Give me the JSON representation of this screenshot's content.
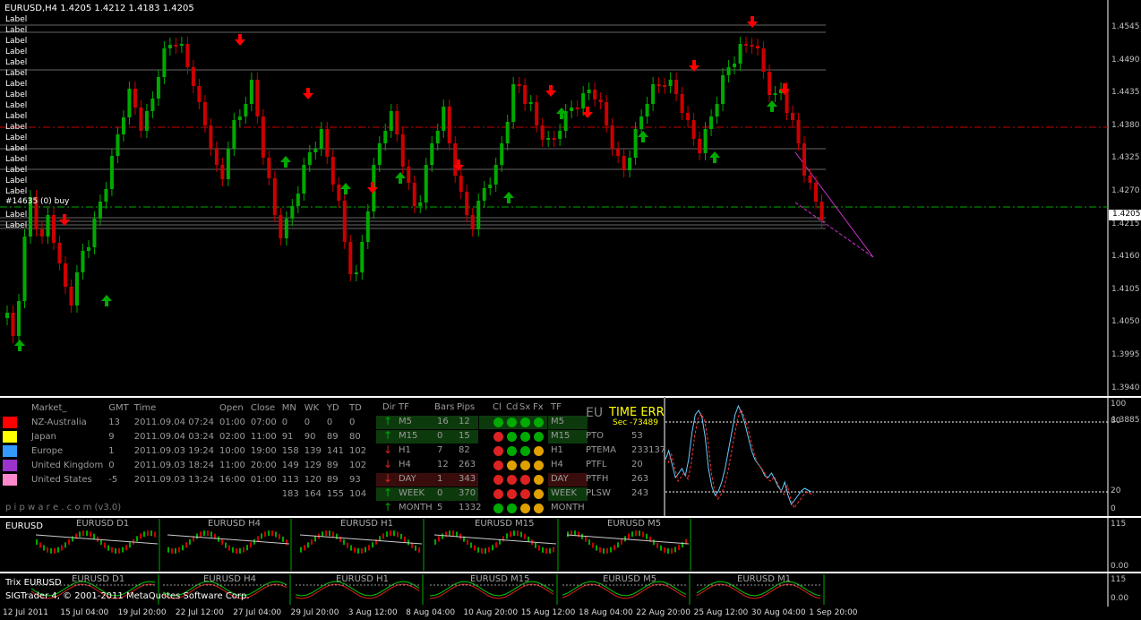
{
  "symbol_header": "EURUSD,H4  1.4205 1.4212 1.4183 1.4205",
  "price_axis": [
    "1.4545",
    "1.4490",
    "1.4435",
    "1.4380",
    "1.4325",
    "1.4270",
    "1.4215",
    "1.4160",
    "1.4105",
    "1.4050",
    "1.3995",
    "1.3940",
    "1.3885"
  ],
  "current_price": "1.4205",
  "label_text": "Label",
  "buy_label": "#14635 (0) buy",
  "time_axis": [
    "12 Jul 2011",
    "15 Jul 04:00",
    "19 Jul 20:00",
    "22 Jul 12:00",
    "27 Jul 04:00",
    "29 Jul 20:00",
    "3 Aug 12:00",
    "8 Aug 04:00",
    "10 Aug 20:00",
    "15 Aug 12:00",
    "18 Aug 04:00",
    "22 Aug 20:00",
    "25 Aug 12:00",
    "30 Aug 04:00",
    "1 Sep 20:00"
  ],
  "markets": {
    "headers": [
      "Market_",
      "GMT",
      "Time",
      "Open",
      "Close",
      "MN",
      "WK",
      "YD",
      "TD"
    ],
    "rows": [
      {
        "name": "NZ-Australia",
        "gmt": "13",
        "time": "2011.09.04 07:24",
        "open": "01:00",
        "close": "07:00",
        "mn": "0",
        "wk": "0",
        "yd": "0",
        "td": "0",
        "color": "#ff0000"
      },
      {
        "name": "Japan",
        "gmt": "9",
        "time": "2011.09.04 03:24",
        "open": "02:00",
        "close": "11:00",
        "mn": "91",
        "wk": "90",
        "yd": "89",
        "td": "80",
        "color": "#ffff00"
      },
      {
        "name": "Europe",
        "gmt": "1",
        "time": "2011.09.03 19:24",
        "open": "10:00",
        "close": "19:00",
        "mn": "158",
        "wk": "139",
        "yd": "141",
        "td": "102",
        "color": "#3399ff"
      },
      {
        "name": "United Kingdom",
        "gmt": "0",
        "time": "2011.09.03 18:24",
        "open": "11:00",
        "close": "20:00",
        "mn": "149",
        "wk": "129",
        "yd": "89",
        "td": "102",
        "color": "#9933cc"
      },
      {
        "name": "United States",
        "gmt": "-5",
        "time": "2011.09.03 13:24",
        "open": "16:00",
        "close": "01:00",
        "mn": "113",
        "wk": "120",
        "yd": "89",
        "td": "93",
        "color": "#ff88cc"
      }
    ],
    "totals": {
      "mn": "183",
      "wk": "164",
      "yd": "155",
      "td": "104"
    },
    "footer": "p i p w a r e . c o m  (v3.0)"
  },
  "timeframes": {
    "headers": [
      "Dir",
      "TF",
      "Bars",
      "Pips",
      "Cl",
      "Cd",
      "Sx",
      "Fx",
      "TF"
    ],
    "rows": [
      {
        "dir": "up",
        "tf": "M5",
        "bars": "16",
        "pips": "12",
        "dots": [
          "g",
          "g",
          "g",
          "g"
        ],
        "tf2": "M5",
        "hl": "green"
      },
      {
        "dir": "up",
        "tf": "M15",
        "bars": "0",
        "pips": "15",
        "dots": [
          "r",
          "g",
          "g",
          "g"
        ],
        "tf2": "M15",
        "hl": "green"
      },
      {
        "dir": "down",
        "tf": "H1",
        "bars": "7",
        "pips": "82",
        "dots": [
          "r",
          "g",
          "g",
          "o"
        ],
        "tf2": "H1",
        "hl": ""
      },
      {
        "dir": "down",
        "tf": "H4",
        "bars": "12",
        "pips": "263",
        "dots": [
          "r",
          "o",
          "o",
          "o"
        ],
        "tf2": "H4",
        "hl": ""
      },
      {
        "dir": "down",
        "tf": "DAY",
        "bars": "1",
        "pips": "343",
        "dots": [
          "r",
          "r",
          "r",
          "o"
        ],
        "tf2": "DAY",
        "hl": "red"
      },
      {
        "dir": "up",
        "tf": "WEEK",
        "bars": "0",
        "pips": "370",
        "dots": [
          "r",
          "r",
          "r",
          "o"
        ],
        "tf2": "WEEK",
        "hl": "green"
      },
      {
        "dir": "up",
        "tf": "MONTH",
        "bars": "5",
        "pips": "1332",
        "dots": [
          "g",
          "g",
          "o",
          "o"
        ],
        "tf2": "MONTH",
        "hl": ""
      }
    ]
  },
  "info": {
    "eu": "EU",
    "time_err": "TIME ERR",
    "sec": "Sec -73489",
    "items": [
      {
        "label": "PTO",
        "value": "53"
      },
      {
        "label": "PTEMA",
        "value": "233137"
      },
      {
        "label": "PTFL",
        "value": "20"
      },
      {
        "label": "PTFH",
        "value": "263"
      },
      {
        "label": "PLSW",
        "value": "243"
      }
    ]
  },
  "stoch_axis": {
    "top": "100",
    "upper": "80",
    "lower": "20",
    "bottom": "0"
  },
  "mini1": {
    "label": "EURUSD",
    "titles": [
      "EURUSD D1",
      "EURUSD H4",
      "EURUSD H1",
      "EURUSD M15",
      "EURUSD M5"
    ],
    "axis_top": "115",
    "axis_bottom": "0.00"
  },
  "mini2": {
    "label": "Trix EURUSD",
    "titles": [
      "EURUSD D1",
      "EURUSD H4",
      "EURUSD H1",
      "EURUSD M15",
      "EURUSD M5",
      "EURUSD M1"
    ],
    "axis_top": "115",
    "axis_bottom": "0.00"
  },
  "copyright": "SIGTrader 4, © 2001-2011 MetaQuotes Software Corp.",
  "colors": {
    "bull": "#00aa00",
    "bear": "#cc0000",
    "grid": "#808080"
  }
}
